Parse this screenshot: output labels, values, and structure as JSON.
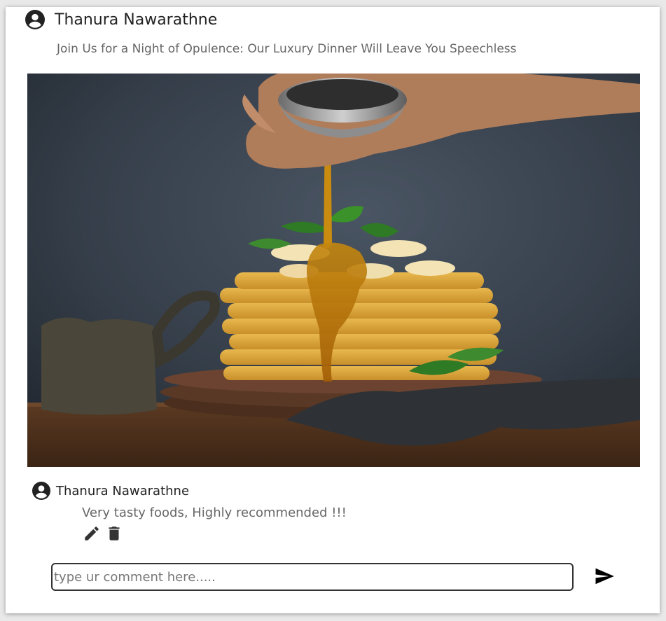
{
  "post": {
    "author": "Thanura Nawarathne",
    "caption": "Join Us for a Night of Opulence: Our Luxury Dinner Will Leave You Speechless",
    "image_alt": "Syrup poured over a stack of pancakes topped with banana and mint"
  },
  "comment": {
    "author": "Thanura Nawarathne",
    "text": "Very tasty foods, Highly recommended !!!"
  },
  "comment_form": {
    "placeholder": "type ur comment here....."
  },
  "icons": {
    "avatar": "account-circle-icon",
    "edit": "pencil-icon",
    "delete": "trash-icon",
    "send": "send-icon"
  }
}
